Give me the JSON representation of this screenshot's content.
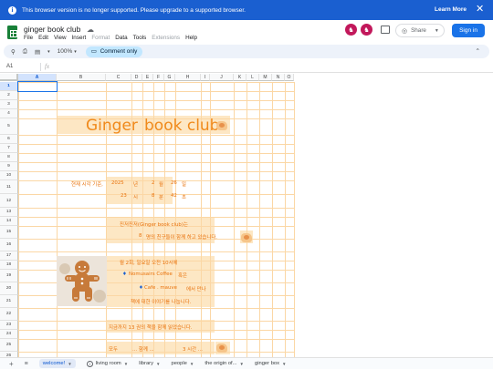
{
  "banner": {
    "message": "This browser version is no longer supported. Please upgrade to a supported browser.",
    "learn_more": "Learn More",
    "close": "✕",
    "info": "i"
  },
  "header": {
    "title": "ginger book club",
    "menu": [
      "File",
      "Edit",
      "View",
      "Insert",
      "Format",
      "Data",
      "Tools",
      "Extensions",
      "Help"
    ],
    "share_label": "Share",
    "signin_label": "Sign in"
  },
  "toolbar": {
    "zoom": "100%",
    "comment_only": "Comment only"
  },
  "formula_bar": {
    "cell_ref": "A1",
    "fx": "fx"
  },
  "grid": {
    "columns": [
      "A",
      "B",
      "C",
      "D",
      "E",
      "F",
      "G",
      "H",
      "I",
      "J",
      "K",
      "L",
      "M",
      "N",
      "O"
    ],
    "rows": [
      "1",
      "2",
      "3",
      "4",
      "5",
      "6",
      "7",
      "8",
      "9",
      "10",
      "11",
      "12",
      "13",
      "14",
      "15",
      "16",
      "17",
      "18",
      "19",
      "20",
      "21",
      "22",
      "23",
      "24",
      "25",
      "26",
      "27"
    ],
    "selected_cell": "A1",
    "cells": {
      "title_word1": "Ginger",
      "title_word2": "book club",
      "r11_label": "현재 시각 기준,",
      "r11_year": "2025",
      "r11_year_unit": "년",
      "r11_month": "2",
      "r11_month_unit": "월",
      "r11_day": "26",
      "r11_day_unit": "일",
      "r12_hour": "23",
      "r12_hour_unit": "시",
      "r12_min": "8",
      "r12_min_unit": "분",
      "r12_sec": "42",
      "r12_sec_unit": "초",
      "r15_text": "진저진저(Ginger book club)는",
      "r16_num": "8",
      "r16_text": "명의 친구들이   함께 하고 있습니다.",
      "r19_text": "월 2회, 일요일 오전 10시에",
      "r20_place": "Nomusairs Coffee",
      "r20_suffix": "혹은",
      "r21_place": "Cafe . mauve",
      "r21_suffix": "에서 만나",
      "r22_text": "책에 대한 이야기를 나눕니다.",
      "r25_text": "지금까지   13   권의 책을 함께 읽었습니다.",
      "r27_a": "모두",
      "r27_b": "... 함께 ...",
      "r27_c": "3 시간 ..."
    }
  },
  "sheet_tabs": [
    {
      "label": "welcome!",
      "active": true
    },
    {
      "label": "living room",
      "active": false,
      "locked": true
    },
    {
      "label": "library",
      "active": false
    },
    {
      "label": "people",
      "active": false
    },
    {
      "label": "the origin of...",
      "active": false
    },
    {
      "label": "ginger box",
      "active": false
    }
  ],
  "colors": {
    "banner": "#1a5fd0",
    "accent_text": "#e8710a",
    "cell_fill": "#fde7c4",
    "grid_line": "#fbd7a5",
    "signin": "#1a73e8"
  }
}
